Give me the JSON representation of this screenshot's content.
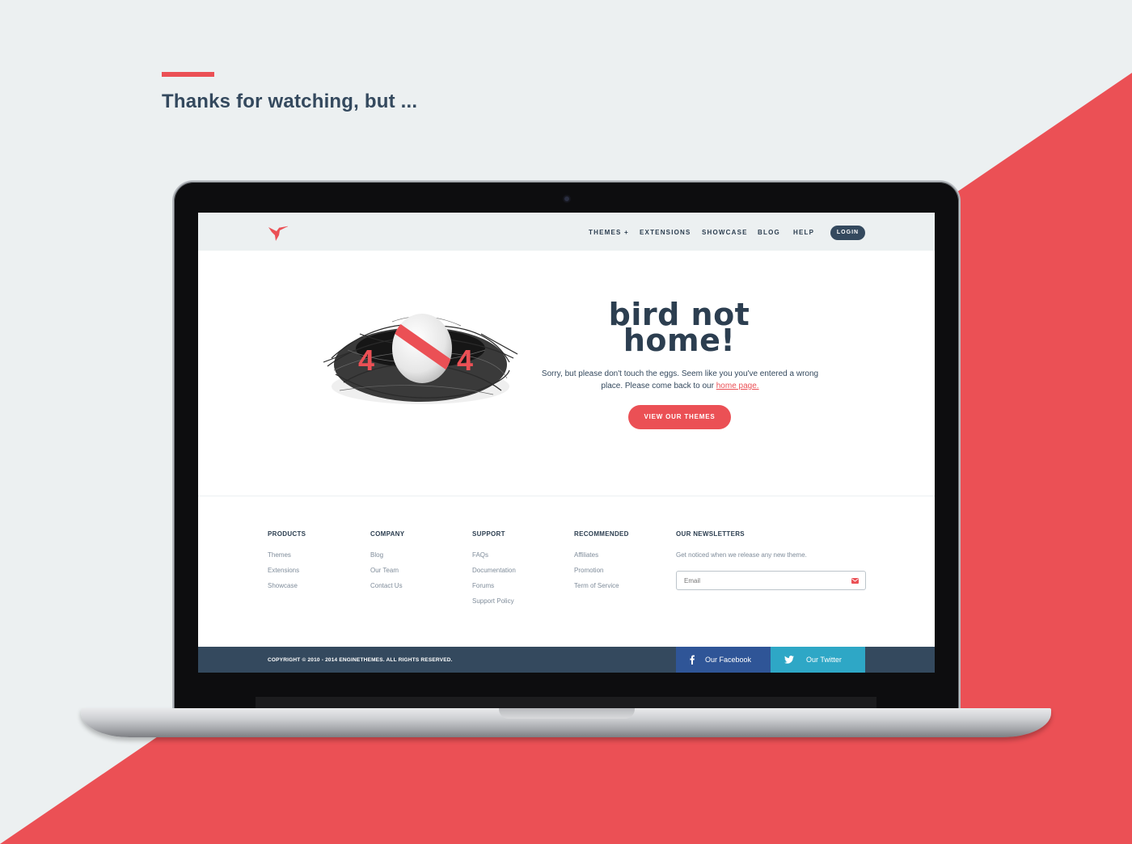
{
  "headline": "Thanks for watching, but ...",
  "colors": {
    "accent": "#eb5055",
    "dark": "#2c3e50",
    "facebook": "#2f5597",
    "twitter": "#2ea7c6"
  },
  "nav": {
    "logo_icon": "hummingbird-logo-icon",
    "items": [
      "THEMES +",
      "EXTENSIONS",
      "SHOWCASE",
      "BLOG",
      "HELP"
    ],
    "login": "LOGIN"
  },
  "hero": {
    "digit_left": "4",
    "digit_right": "4",
    "title_line1": "bird not",
    "title_line2": "home!",
    "description": "Sorry, but please don't touch the eggs. Seem like you you've entered a wrong place. Please come back to our",
    "home_link": "home page.",
    "cta": "VIEW OUR THEMES"
  },
  "footer": {
    "columns": [
      {
        "title": "PRODUCTS",
        "links": [
          "Themes",
          "Extensions",
          "Showcase"
        ]
      },
      {
        "title": "COMPANY",
        "links": [
          "Blog",
          "Our Team",
          "Contact Us"
        ]
      },
      {
        "title": "SUPPORT",
        "links": [
          "FAQs",
          "Documentation",
          "Forums",
          "Support Policy"
        ]
      },
      {
        "title": "RECOMMENDED",
        "links": [
          "Affiliates",
          "Promotion",
          "Term of Service"
        ]
      }
    ],
    "newsletter": {
      "title": "OUR NEWSLETTERS",
      "note": "Get noticed when we release any new theme.",
      "placeholder": "Email"
    }
  },
  "bottom_bar": {
    "copyright": "COPYRIGHT © 2010 - 2014 ENGINETHEMES. ALL RIGHTS RESERVED.",
    "facebook": "Our Facebook",
    "twitter": "Our Twitter"
  }
}
